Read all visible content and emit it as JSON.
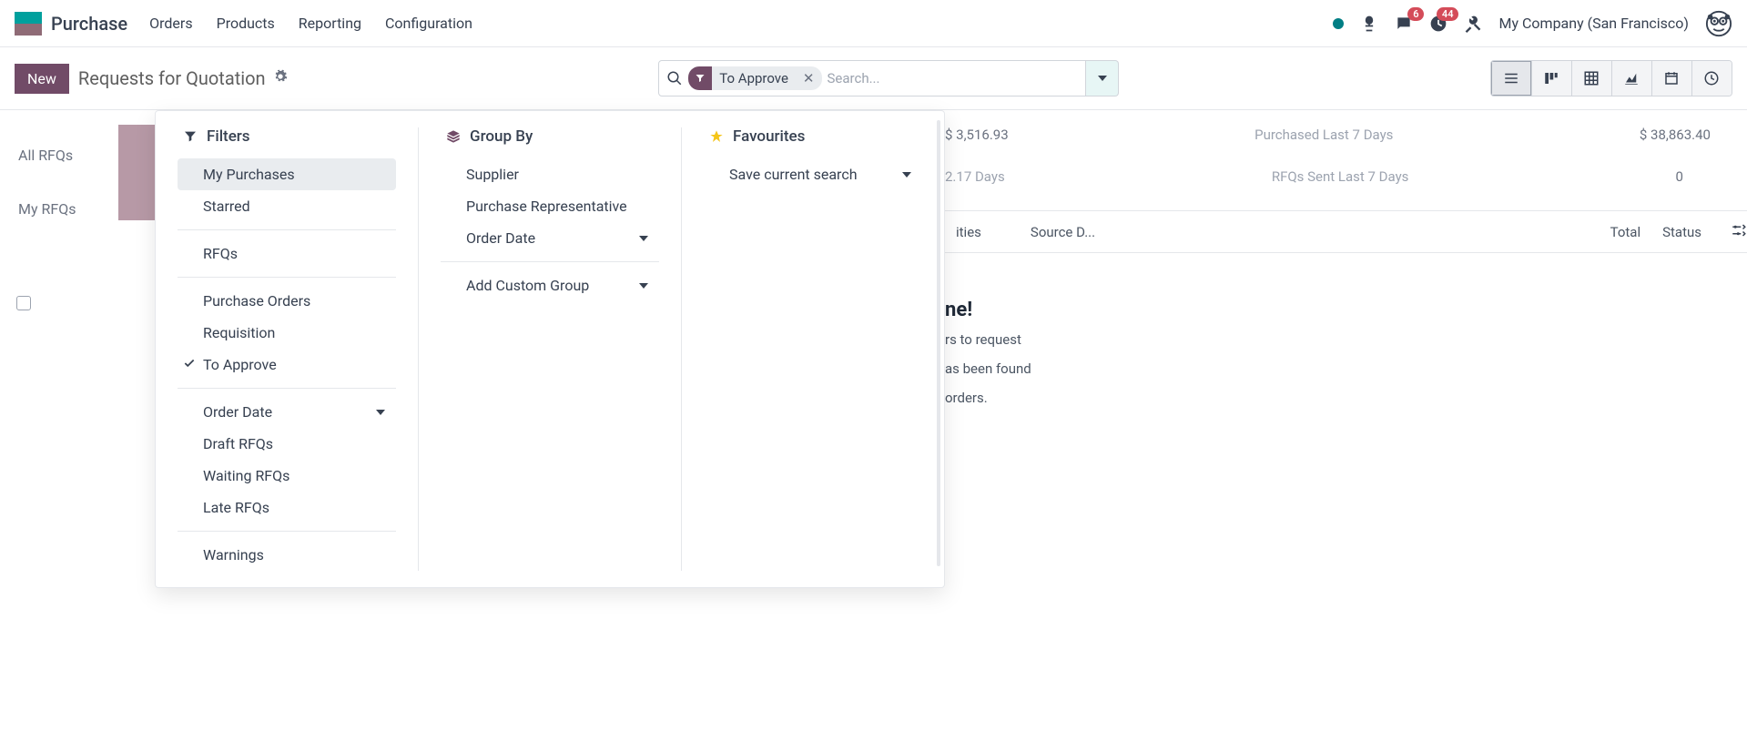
{
  "app": {
    "name": "Purchase"
  },
  "nav": {
    "menu": [
      "Orders",
      "Products",
      "Reporting",
      "Configuration"
    ],
    "badge_msg": "6",
    "badge_act": "44",
    "company": "My Company (San Francisco)"
  },
  "control": {
    "new_btn": "New",
    "title": "Requests for Quotation",
    "search_placeholder": "Search...",
    "facet_label": "To Approve"
  },
  "leftpanel": {
    "all": "All RFQs",
    "my": "My RFQs"
  },
  "kpi": {
    "amount1_label": "",
    "amount1": "$ 3,516.93",
    "p7_label": "Purchased Last 7 Days",
    "p7_value": "$ 38,863.40",
    "days_value": "2.17 Days",
    "sent7_label": "RFQs Sent Last 7 Days",
    "sent7_value": "0"
  },
  "table": {
    "col_activities": "ities",
    "col_source": "Source D...",
    "col_total": "Total",
    "col_status": "Status"
  },
  "dropdown": {
    "filters_title": "Filters",
    "filters": {
      "my_purchases": "My Purchases",
      "starred": "Starred",
      "rfqs": "RFQs",
      "purchase_orders": "Purchase Orders",
      "requisition": "Requisition",
      "to_approve": "To Approve",
      "order_date": "Order Date",
      "draft_rfqs": "Draft RFQs",
      "waiting_rfqs": "Waiting RFQs",
      "late_rfqs": "Late RFQs",
      "warnings": "Warnings"
    },
    "groupby_title": "Group By",
    "groupby": {
      "supplier": "Supplier",
      "purchase_rep": "Purchase Representative",
      "order_date": "Order Date",
      "add_custom": "Add Custom Group"
    },
    "fav_title": "Favourites",
    "fav": {
      "save": "Save current search"
    }
  },
  "empty": {
    "title_frag": "ne!",
    "line1_frag": "rs to request",
    "line2_frag": "as been found",
    "line3_frag": " orders."
  }
}
